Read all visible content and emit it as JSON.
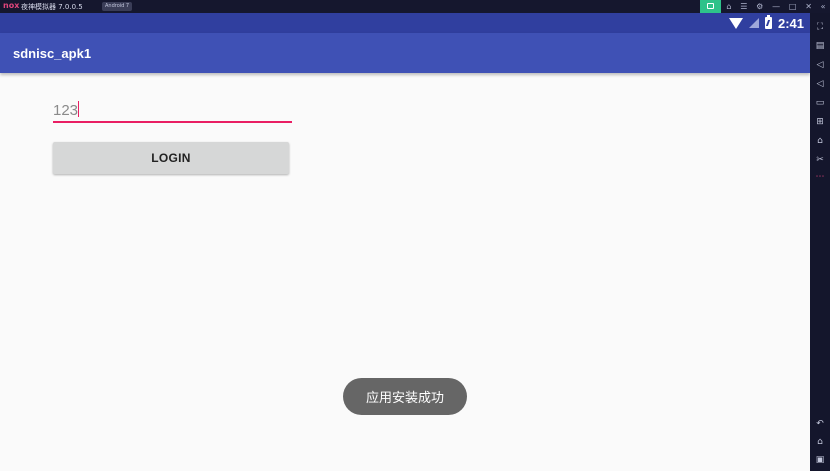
{
  "emulator": {
    "logo": "nox",
    "title": "夜神模拟器 7.0.0.5",
    "android_badge": "Android 7"
  },
  "status_bar": {
    "time": "2:41"
  },
  "app": {
    "title": "sdnisc_apk1",
    "input_value": "123",
    "login_label": "LOGIN"
  },
  "toast": {
    "message": "应用安装成功"
  },
  "colors": {
    "status_bar": "#303f9f",
    "app_bar": "#3f51b5",
    "accent": "#e91e63",
    "emulator_chrome": "#15172e"
  }
}
